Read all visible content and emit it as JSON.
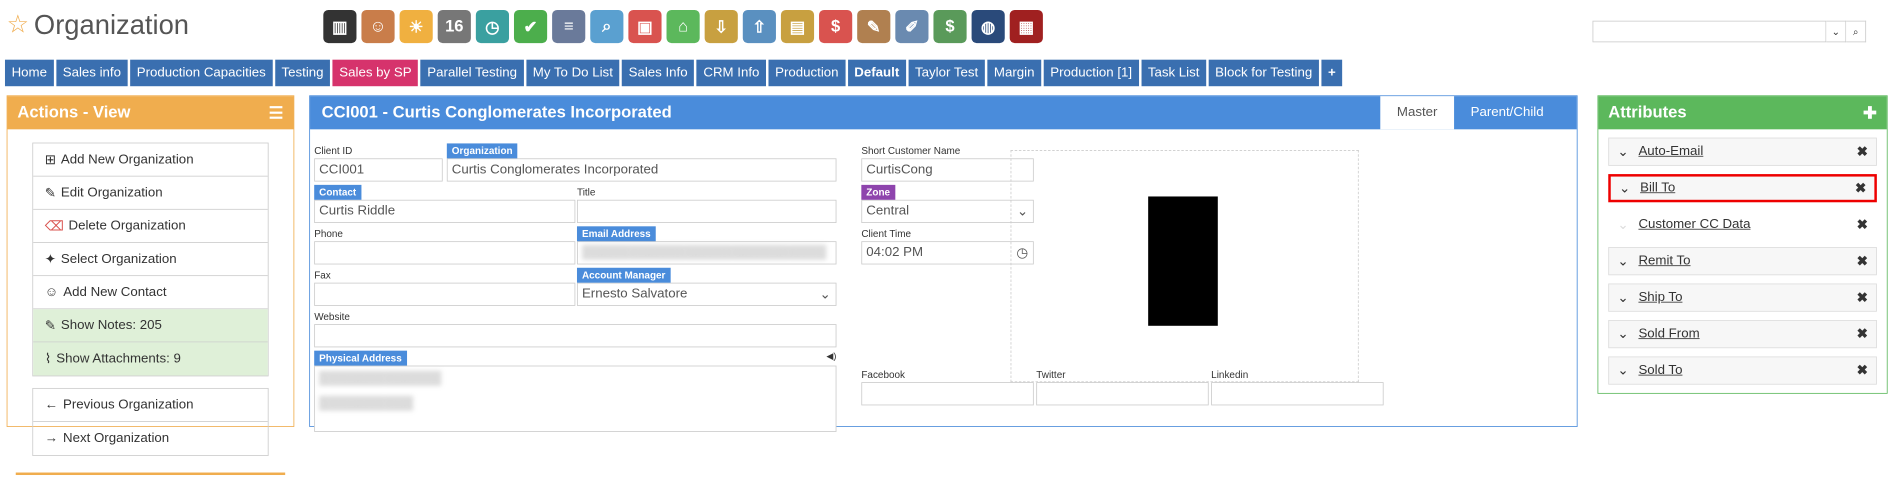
{
  "page_title": "Organization",
  "search": {
    "placeholder": ""
  },
  "tabs": [
    "Home",
    "Sales info",
    "Production Capacities",
    "Testing",
    "Sales by SP",
    "Parallel Testing",
    "My To Do List",
    "Sales Info",
    "CRM Info",
    "Production",
    "Default",
    "Taylor Test",
    "Margin",
    "Production [1]",
    "Task List",
    "Block for Testing",
    "+"
  ],
  "left": {
    "title": "Actions - View",
    "items": [
      "Add New Organization",
      "Edit Organization",
      "Delete Organization",
      "Select Organization",
      "Add New Contact",
      "Show Notes: 205",
      "Show Attachments: 9"
    ],
    "nav": [
      "Previous Organization",
      "Next Organization"
    ]
  },
  "center": {
    "title": "CCI001 - Curtis Conglomerates Incorporated",
    "tab_master": "Master",
    "tab_parent": "Parent/Child",
    "labels": {
      "client_id": "Client ID",
      "organization": "Organization",
      "short_name": "Short Customer Name",
      "contact": "Contact",
      "title": "Title",
      "zone": "Zone",
      "phone": "Phone",
      "email": "Email Address",
      "client_time": "Client Time",
      "fax": "Fax",
      "account_manager": "Account Manager",
      "website": "Website",
      "physical_address": "Physical Address",
      "facebook": "Facebook",
      "twitter": "Twitter",
      "linkedin": "Linkedin"
    },
    "values": {
      "client_id": "CCI001",
      "organization": "Curtis Conglomerates Incorporated",
      "short_name": "CurtisCong",
      "contact": "Curtis Riddle",
      "zone": "Central",
      "client_time": "04:02 PM",
      "account_manager": "Ernesto Salvatore"
    }
  },
  "right": {
    "title": "Attributes",
    "items": [
      "Auto-Email",
      "Bill To",
      "Customer CC Data",
      "Remit To",
      "Ship To",
      "Sold From",
      "Sold To"
    ]
  }
}
